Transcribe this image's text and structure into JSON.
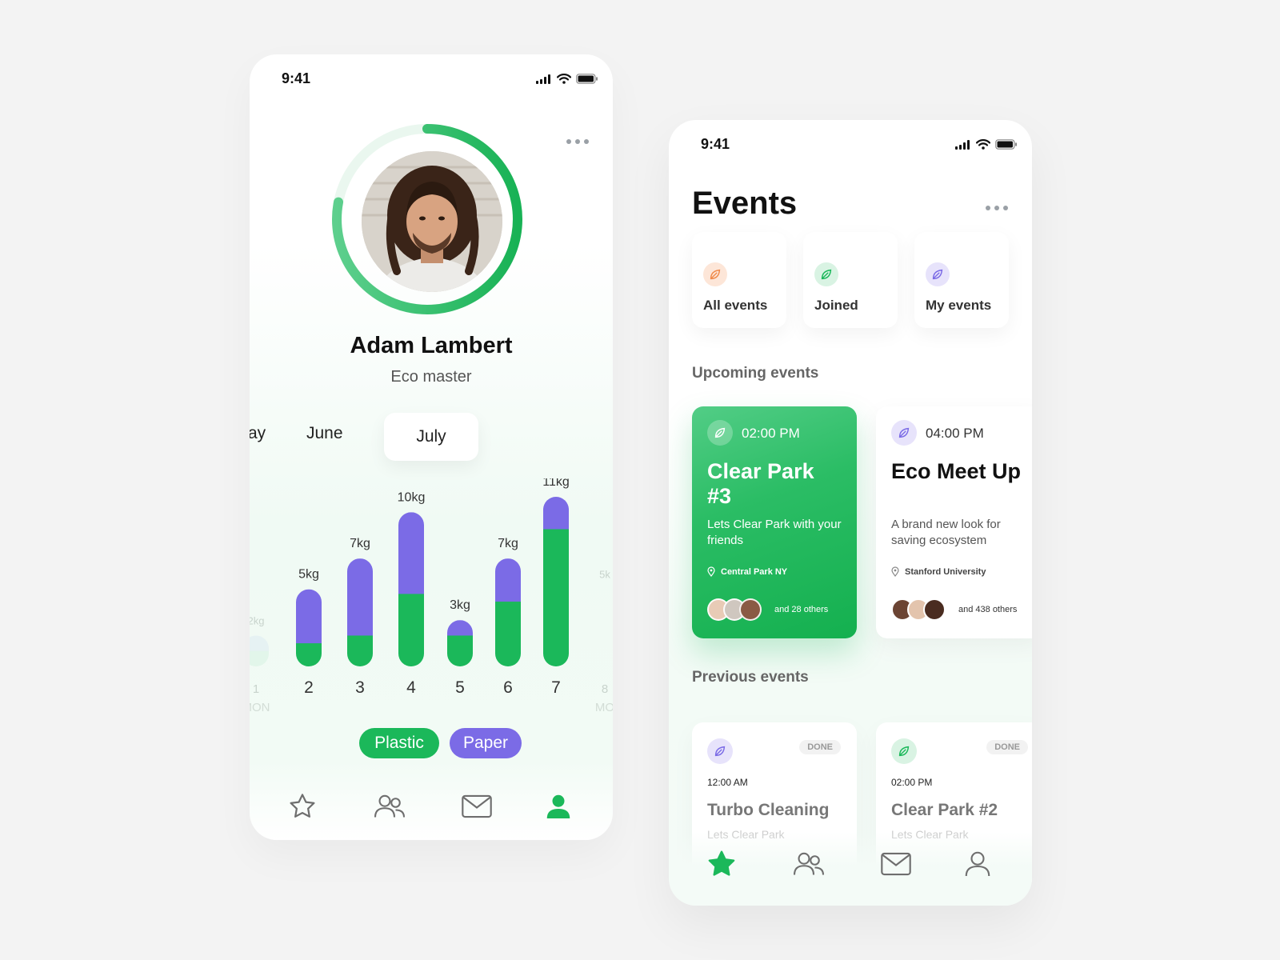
{
  "colors": {
    "green": "#1bb85a",
    "purple": "#7b6be6",
    "orange": "#f08a4b",
    "icon_gray": "#6e6e6e"
  },
  "profile_screen": {
    "status_time": "9:41",
    "name": "Adam Lambert",
    "role": "Eco master",
    "progress_fraction": 0.78,
    "months": [
      "ay",
      "June",
      "July"
    ],
    "selected_month": "July",
    "legend": {
      "plastic": "Plastic",
      "paper": "Paper"
    },
    "tabs": [
      "star-icon",
      "friends-icon",
      "mail-icon",
      "profile-icon"
    ],
    "active_tab": "profile-icon"
  },
  "chart_data": {
    "type": "bar",
    "stacked": true,
    "categories": [
      "1",
      "2",
      "3",
      "4",
      "5",
      "6",
      "7",
      "8"
    ],
    "x_sublabels": {
      "1": "MON",
      "8": "MO"
    },
    "faded_categories": [
      "1",
      "8"
    ],
    "value_labels": [
      "2kg",
      "5kg",
      "7kg",
      "10kg",
      "3kg",
      "7kg",
      "11kg",
      "5k"
    ],
    "series": [
      {
        "name": "Plastic",
        "color": "#1bb85a",
        "values": [
          1.0,
          1.5,
          2.0,
          4.7,
          2.0,
          4.2,
          8.9,
          null
        ]
      },
      {
        "name": "Paper",
        "color": "#7b6be6",
        "values": [
          1.0,
          3.5,
          5.0,
          5.3,
          1.0,
          2.8,
          2.1,
          null
        ]
      }
    ],
    "totals": [
      2,
      5,
      7,
      10,
      3,
      7,
      11,
      5
    ],
    "ylim": [
      0,
      11
    ]
  },
  "events_screen": {
    "status_time": "9:41",
    "title": "Events",
    "filters": [
      {
        "label": "All events",
        "icon": "leaf-icon",
        "color": "#f08a4b"
      },
      {
        "label": "Joined",
        "icon": "leaf-icon",
        "color": "#1bb85a"
      },
      {
        "label": "My events",
        "icon": "leaf-icon",
        "color": "#7b6be6"
      }
    ],
    "upcoming_title": "Upcoming events",
    "upcoming": [
      {
        "time": "02:00 PM",
        "title": "Clear Park #3",
        "description": "Lets Clear Park  with your friends",
        "location": "Central Park NY",
        "others": "and 28 others"
      },
      {
        "time": "04:00 PM",
        "title": "Eco Meet Up",
        "description": "A brand new look for saving ecosystem",
        "location": "Stanford University",
        "others": "and 438 others"
      }
    ],
    "previous_title": "Previous events",
    "previous": [
      {
        "badge": "DONE",
        "time": "12:00 AM",
        "title": "Turbo Cleaning",
        "subtitle": "Lets Clear Park"
      },
      {
        "badge": "DONE",
        "time": "02:00 PM",
        "title": "Clear Park #2",
        "subtitle": "Lets Clear Park"
      }
    ],
    "tabs": [
      "star-icon",
      "friends-icon",
      "mail-icon",
      "profile-icon"
    ],
    "active_tab": "star-icon"
  }
}
